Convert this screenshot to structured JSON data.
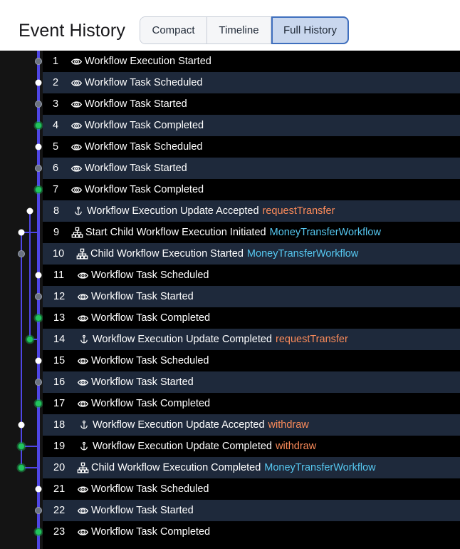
{
  "header": {
    "title": "Event History",
    "view_options": [
      "Compact",
      "Timeline",
      "Full History"
    ],
    "active_view": "Full History"
  },
  "colors": {
    "main_line": "#4f46e5",
    "child_line": "#6b7280",
    "node_completed": "#22c55e",
    "node_scheduled": "#ffffff",
    "node_started": "#6b7280",
    "detail_orange": "#fb8b5a",
    "detail_cyan": "#56c7f0",
    "row_alt": "#1e293b"
  },
  "events": [
    {
      "id": "1",
      "name": "Workflow Execution Started",
      "icon": "eye-icon",
      "detail": "",
      "detail_color": "",
      "node": "started",
      "lane": 0
    },
    {
      "id": "2",
      "name": "Workflow Task Scheduled",
      "icon": "eye-icon",
      "detail": "",
      "detail_color": "",
      "node": "scheduled",
      "lane": 0
    },
    {
      "id": "3",
      "name": "Workflow Task Started",
      "icon": "eye-icon",
      "detail": "",
      "detail_color": "",
      "node": "started",
      "lane": 0
    },
    {
      "id": "4",
      "name": "Workflow Task Completed",
      "icon": "eye-icon",
      "detail": "",
      "detail_color": "",
      "node": "completed",
      "lane": 0
    },
    {
      "id": "5",
      "name": "Workflow Task Scheduled",
      "icon": "eye-icon",
      "detail": "",
      "detail_color": "",
      "node": "scheduled",
      "lane": 0
    },
    {
      "id": "6",
      "name": "Workflow Task Started",
      "icon": "eye-icon",
      "detail": "",
      "detail_color": "",
      "node": "started",
      "lane": 0
    },
    {
      "id": "7",
      "name": "Workflow Task Completed",
      "icon": "eye-icon",
      "detail": "",
      "detail_color": "",
      "node": "completed",
      "lane": 0
    },
    {
      "id": "8",
      "name": "Workflow Execution Update Accepted",
      "icon": "anchor-icon",
      "detail": "requestTransfer",
      "detail_color": "orange",
      "node": "scheduled",
      "lane": 1
    },
    {
      "id": "9",
      "name": "Start Child Workflow Execution Initiated",
      "icon": "hierarchy-icon",
      "detail": "MoneyTransferWorkflow",
      "detail_color": "cyan",
      "node": "scheduled",
      "lane": 2
    },
    {
      "id": "10",
      "name": "Child Workflow Execution Started",
      "icon": "hierarchy-icon",
      "detail": "MoneyTransferWorkflow",
      "detail_color": "cyan",
      "node": "started",
      "lane": 2
    },
    {
      "id": "11",
      "name": "Workflow Task Scheduled",
      "icon": "eye-icon",
      "detail": "",
      "detail_color": "",
      "node": "scheduled",
      "lane": 0
    },
    {
      "id": "12",
      "name": "Workflow Task Started",
      "icon": "eye-icon",
      "detail": "",
      "detail_color": "",
      "node": "started",
      "lane": 0
    },
    {
      "id": "13",
      "name": "Workflow Task Completed",
      "icon": "eye-icon",
      "detail": "",
      "detail_color": "",
      "node": "completed",
      "lane": 0
    },
    {
      "id": "14",
      "name": "Workflow Execution Update Completed",
      "icon": "anchor-icon",
      "detail": "requestTransfer",
      "detail_color": "orange",
      "node": "completed",
      "lane": 1
    },
    {
      "id": "15",
      "name": "Workflow Task Scheduled",
      "icon": "eye-icon",
      "detail": "",
      "detail_color": "",
      "node": "scheduled",
      "lane": 0
    },
    {
      "id": "16",
      "name": "Workflow Task Started",
      "icon": "eye-icon",
      "detail": "",
      "detail_color": "",
      "node": "started",
      "lane": 0
    },
    {
      "id": "17",
      "name": "Workflow Task Completed",
      "icon": "eye-icon",
      "detail": "",
      "detail_color": "",
      "node": "completed",
      "lane": 0
    },
    {
      "id": "18",
      "name": "Workflow Execution Update Accepted",
      "icon": "anchor-icon",
      "detail": "withdraw",
      "detail_color": "orange",
      "node": "scheduled",
      "lane": 2
    },
    {
      "id": "19",
      "name": "Workflow Execution Update Completed",
      "icon": "anchor-icon",
      "detail": "withdraw",
      "detail_color": "orange",
      "node": "completed",
      "lane": 2
    },
    {
      "id": "20",
      "name": "Child Workflow Execution Completed",
      "icon": "hierarchy-icon",
      "detail": "MoneyTransferWorkflow",
      "detail_color": "cyan",
      "node": "completed",
      "lane": 2
    },
    {
      "id": "21",
      "name": "Workflow Task Scheduled",
      "icon": "eye-icon",
      "detail": "",
      "detail_color": "",
      "node": "scheduled",
      "lane": 0
    },
    {
      "id": "22",
      "name": "Workflow Task Started",
      "icon": "eye-icon",
      "detail": "",
      "detail_color": "",
      "node": "started",
      "lane": 0
    },
    {
      "id": "23",
      "name": "Workflow Task Completed",
      "icon": "eye-icon",
      "detail": "",
      "detail_color": "",
      "node": "completed",
      "lane": 0
    }
  ]
}
